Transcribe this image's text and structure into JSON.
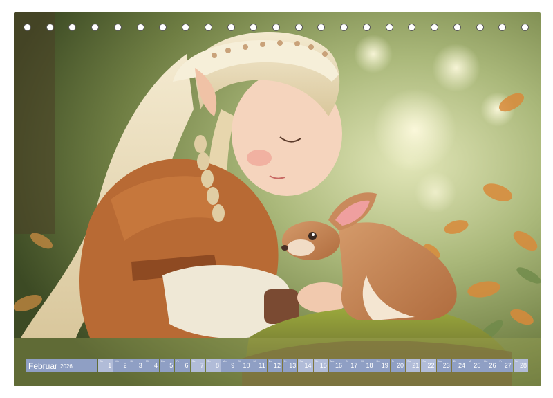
{
  "calendar": {
    "month": "Februar",
    "year": "2026",
    "days": [
      {
        "wd": "So",
        "num": "1",
        "weekend": true
      },
      {
        "wd": "Mo",
        "num": "2",
        "weekend": false
      },
      {
        "wd": "Di",
        "num": "3",
        "weekend": false
      },
      {
        "wd": "Mi",
        "num": "4",
        "weekend": false
      },
      {
        "wd": "Do",
        "num": "5",
        "weekend": false
      },
      {
        "wd": "Fr",
        "num": "6",
        "weekend": false
      },
      {
        "wd": "Sa",
        "num": "7",
        "weekend": true
      },
      {
        "wd": "So",
        "num": "8",
        "weekend": true
      },
      {
        "wd": "Mo",
        "num": "9",
        "weekend": false
      },
      {
        "wd": "Di",
        "num": "10",
        "weekend": false
      },
      {
        "wd": "Mi",
        "num": "11",
        "weekend": false
      },
      {
        "wd": "Do",
        "num": "12",
        "weekend": false
      },
      {
        "wd": "Fr",
        "num": "13",
        "weekend": false
      },
      {
        "wd": "Sa",
        "num": "14",
        "weekend": true
      },
      {
        "wd": "So",
        "num": "15",
        "weekend": true
      },
      {
        "wd": "Mo",
        "num": "16",
        "weekend": false
      },
      {
        "wd": "Di",
        "num": "17",
        "weekend": false
      },
      {
        "wd": "Mi",
        "num": "18",
        "weekend": false
      },
      {
        "wd": "Do",
        "num": "19",
        "weekend": false
      },
      {
        "wd": "Fr",
        "num": "20",
        "weekend": false
      },
      {
        "wd": "Sa",
        "num": "21",
        "weekend": true
      },
      {
        "wd": "So",
        "num": "22",
        "weekend": true
      },
      {
        "wd": "Mo",
        "num": "23",
        "weekend": false
      },
      {
        "wd": "Di",
        "num": "24",
        "weekend": false
      },
      {
        "wd": "Mi",
        "num": "25",
        "weekend": false
      },
      {
        "wd": "Do",
        "num": "26",
        "weekend": false
      },
      {
        "wd": "Fr",
        "num": "27",
        "weekend": false
      },
      {
        "wd": "Sa",
        "num": "28",
        "weekend": true
      }
    ]
  },
  "binding": {
    "ring_count": 23
  },
  "colors": {
    "bar": "#8f9fc4",
    "bar_weekend": "#b1bcd8"
  }
}
